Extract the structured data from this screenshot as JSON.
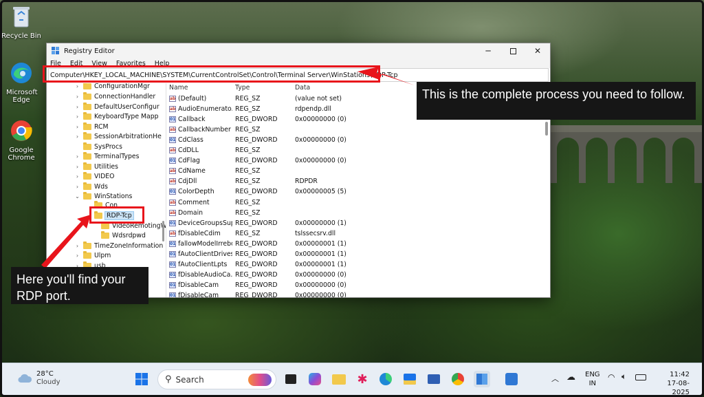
{
  "desktop": {
    "icons": [
      {
        "label": "Recycle Bin",
        "icon": "recycle-bin-icon"
      },
      {
        "label": "Microsoft Edge",
        "icon": "edge-icon"
      },
      {
        "label": "Google Chrome",
        "icon": "chrome-icon"
      }
    ]
  },
  "window": {
    "title": "Registry Editor",
    "menu": [
      "File",
      "Edit",
      "View",
      "Favorites",
      "Help"
    ],
    "address": "Computer\\HKEY_LOCAL_MACHINE\\SYSTEM\\CurrentControlSet\\Control\\Terminal Server\\WinStations\\RDP-Tcp",
    "tree": [
      {
        "label": "ConfigurationMgr",
        "chev": "›"
      },
      {
        "label": "ConnectionHandler",
        "chev": "›"
      },
      {
        "label": "DefaultUserConfigur",
        "chev": "›"
      },
      {
        "label": "KeyboardType Mapp",
        "chev": "›"
      },
      {
        "label": "RCM",
        "chev": "›"
      },
      {
        "label": "SessionArbitrationHe",
        "chev": "›"
      },
      {
        "label": "SysProcs",
        "chev": ""
      },
      {
        "label": "TerminalTypes",
        "chev": "›"
      },
      {
        "label": "Utilities",
        "chev": "›"
      },
      {
        "label": "VIDEO",
        "chev": "›"
      },
      {
        "label": "Wds",
        "chev": "›"
      },
      {
        "label": "WinStations",
        "chev": "⌄"
      },
      {
        "label": "Con",
        "chev": ""
      },
      {
        "label": "RDP-Tcp",
        "chev": "⌄"
      },
      {
        "label": "VideoRemotingW",
        "chev": ""
      },
      {
        "label": "Wdsrdpwd",
        "chev": ""
      },
      {
        "label": "TimeZoneInformation",
        "chev": "›"
      },
      {
        "label": "Ulpm",
        "chev": "›"
      },
      {
        "label": "usb",
        "chev": "›"
      }
    ],
    "columns": {
      "name": "Name",
      "type": "Type",
      "data": "Data"
    },
    "values": [
      {
        "name": "(Default)",
        "type": "REG_SZ",
        "data": "(value not set)"
      },
      {
        "name": "AudioEnumerato...",
        "type": "REG_SZ",
        "data": "rdpendp.dll"
      },
      {
        "name": "Callback",
        "type": "REG_DWORD",
        "data": "0x00000000 (0)"
      },
      {
        "name": "CallbackNumber",
        "type": "REG_SZ",
        "data": ""
      },
      {
        "name": "CdClass",
        "type": "REG_DWORD",
        "data": "0x00000000 (0)"
      },
      {
        "name": "CdDLL",
        "type": "REG_SZ",
        "data": ""
      },
      {
        "name": "CdFlag",
        "type": "REG_DWORD",
        "data": "0x00000000 (0)"
      },
      {
        "name": "CdName",
        "type": "REG_SZ",
        "data": ""
      },
      {
        "name": "CdjDll",
        "type": "REG_SZ",
        "data": "RDPDR"
      },
      {
        "name": "ColorDepth",
        "type": "REG_DWORD",
        "data": "0x00000005 (5)"
      },
      {
        "name": "Comment",
        "type": "REG_SZ",
        "data": ""
      },
      {
        "name": "Domain",
        "type": "REG_SZ",
        "data": ""
      },
      {
        "name": "DeviceGroupsSup...",
        "type": "REG_DWORD",
        "data": "0x00000000 (1)"
      },
      {
        "name": "fDisableCdim",
        "type": "REG_SZ",
        "data": "tslssecsrv.dll"
      },
      {
        "name": "fallowModelIrrebo...",
        "type": "REG_DWORD",
        "data": "0x00000001 (1)"
      },
      {
        "name": "fAutoClientDrives",
        "type": "REG_DWORD",
        "data": "0x00000001 (1)"
      },
      {
        "name": "fAutoClientLpts",
        "type": "REG_DWORD",
        "data": "0x00000001 (1)"
      },
      {
        "name": "fDisableAudioCa...",
        "type": "REG_DWORD",
        "data": "0x00000000 (0)"
      },
      {
        "name": "fDisableCam",
        "type": "REG_DWORD",
        "data": "0x00000000 (0)"
      },
      {
        "name": "fDisableCam",
        "type": "REG_DWORD",
        "data": "0x00000000 (0)"
      }
    ]
  },
  "annotations": {
    "top_callout": "This is the complete process you need to follow.",
    "bottom_callout": "Here you'll find your RDP port."
  },
  "taskbar": {
    "weather_temp": "28°C",
    "weather_desc": "Cloudy",
    "search_label": "Search",
    "lang_1": "ENG",
    "lang_2": "IN",
    "time": "11:42",
    "date": "17-08-2025"
  },
  "colors": {
    "annotation_red": "#e8141b",
    "callout_bg": "#161616",
    "folder": "#f2c94c"
  }
}
